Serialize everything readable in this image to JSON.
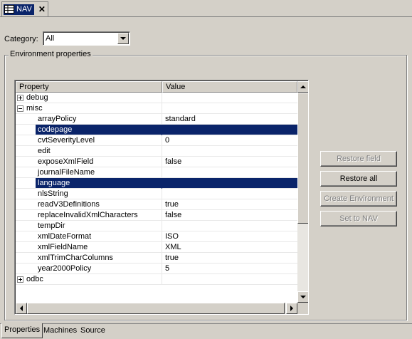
{
  "window": {
    "tab_label": "NAV",
    "tab_icon": "grid-icon",
    "close_symbol": "✕"
  },
  "category": {
    "label": "Category:",
    "selected": "All"
  },
  "group": {
    "title": "Environment properties"
  },
  "table": {
    "columns": [
      "Property",
      "Value"
    ],
    "rows": [
      {
        "type": "group",
        "name": "debug",
        "value": "",
        "expanded": false
      },
      {
        "type": "group",
        "name": "misc",
        "value": "",
        "expanded": true
      },
      {
        "type": "child",
        "name": "arrayPolicy",
        "value": "standard"
      },
      {
        "type": "child",
        "name": "codepage",
        "value": "",
        "selected": true
      },
      {
        "type": "child",
        "name": "cvtSeverityLevel",
        "value": "0"
      },
      {
        "type": "child",
        "name": "edit",
        "value": ""
      },
      {
        "type": "child",
        "name": "exposeXmlField",
        "value": "false"
      },
      {
        "type": "child",
        "name": "journalFileName",
        "value": ""
      },
      {
        "type": "child",
        "name": "language",
        "value": "",
        "selected": true
      },
      {
        "type": "child",
        "name": "nlsString",
        "value": ""
      },
      {
        "type": "child",
        "name": "readV3Definitions",
        "value": "true"
      },
      {
        "type": "child",
        "name": "replaceInvalidXmlCharacters",
        "value": "false"
      },
      {
        "type": "child",
        "name": "tempDir",
        "value": ""
      },
      {
        "type": "child",
        "name": "xmlDateFormat",
        "value": "ISO"
      },
      {
        "type": "child",
        "name": "xmlFieldName",
        "value": "XML"
      },
      {
        "type": "child",
        "name": "xmlTrimCharColumns",
        "value": "true"
      },
      {
        "type": "child",
        "name": "year2000Policy",
        "value": "5"
      },
      {
        "type": "group",
        "name": "odbc",
        "value": "",
        "expanded": false
      }
    ]
  },
  "buttons": {
    "restore_field": "Restore field",
    "restore_all": "Restore all",
    "create_environment": "Create Environment",
    "set_to_nav": "Set to NAV"
  },
  "bottom_tabs": [
    "Properties",
    "Machines",
    "Source"
  ],
  "colors": {
    "selection": "#0a246a",
    "face": "#d4d0c8"
  }
}
